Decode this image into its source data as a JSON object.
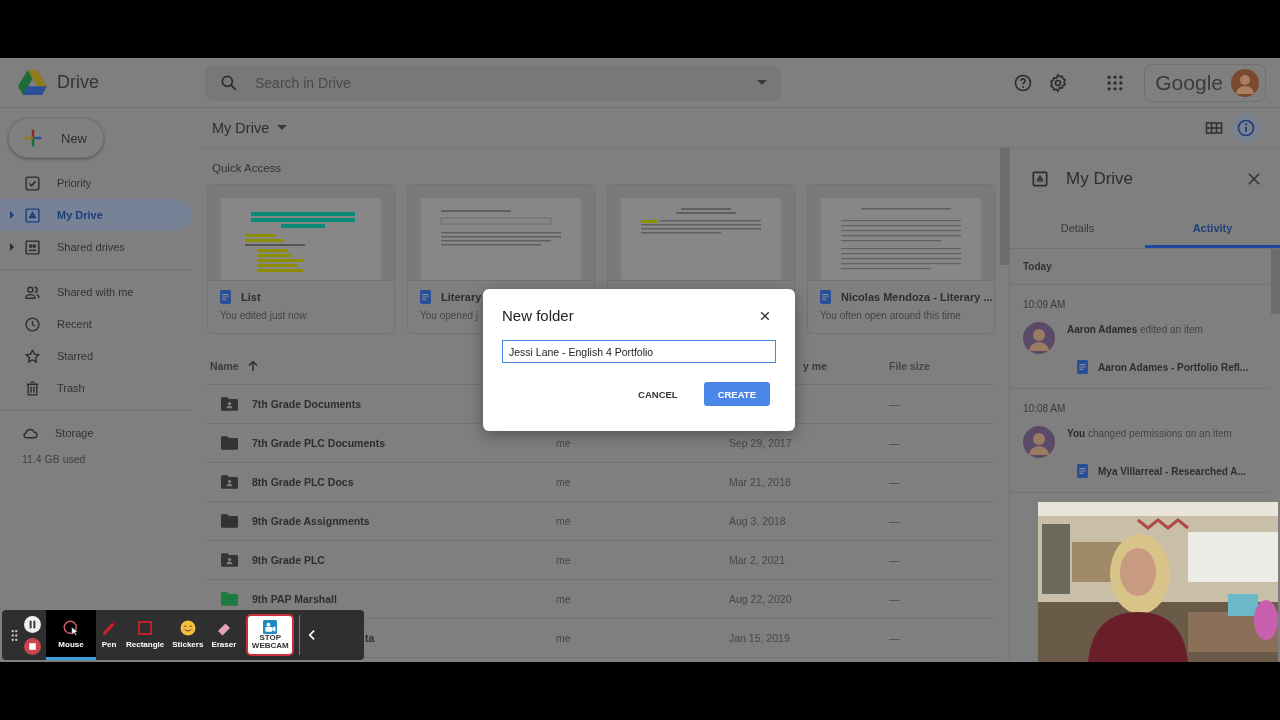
{
  "header": {
    "product": "Drive",
    "search": {
      "placeholder": "Search in Drive"
    },
    "account_label": "Google"
  },
  "sidebar": {
    "new_button": "New",
    "groups": [
      {
        "items": [
          {
            "kind": "priority",
            "label": "Priority",
            "selected": false,
            "expandable": false
          },
          {
            "kind": "my-drive",
            "label": "My Drive",
            "selected": true,
            "expandable": true
          },
          {
            "kind": "shared-drives",
            "label": "Shared drives",
            "selected": false,
            "expandable": true
          }
        ]
      },
      {
        "items": [
          {
            "kind": "shared-with-me",
            "label": "Shared with me",
            "selected": false,
            "expandable": false
          },
          {
            "kind": "recent",
            "label": "Recent",
            "selected": false,
            "expandable": false
          },
          {
            "kind": "starred",
            "label": "Starred",
            "selected": false,
            "expandable": false
          },
          {
            "kind": "trash",
            "label": "Trash",
            "selected": false,
            "expandable": false
          }
        ]
      }
    ],
    "storage": {
      "label": "Storage",
      "usage": "11.4 GB used"
    }
  },
  "main": {
    "title": "My Drive",
    "quick_access": {
      "title": "Quick Access",
      "cards": [
        {
          "kind": "highlighted",
          "name": "List",
          "note": "You edited just now"
        },
        {
          "kind": "form",
          "name": "Literary",
          "note": "You opened j"
        },
        {
          "kind": "labelled"
        },
        {
          "kind": "essay",
          "name": "Nicolas Mendoza - Literary ...",
          "note": "You often open around this time"
        }
      ]
    },
    "table": {
      "columns": {
        "name": "Name",
        "column_3": "y me",
        "file_size": "File size"
      },
      "sort_ascending": true,
      "rows": [
        {
          "kind": "shared",
          "name": "7th Grade Documents",
          "size": "—"
        },
        {
          "kind": "plain",
          "name": "7th Grade PLC Documents",
          "owner": "me",
          "modified": "Sep 29, 2017",
          "size": "—"
        },
        {
          "kind": "shared",
          "name": "8th Grade PLC Docs",
          "owner": "me",
          "modified": "Mar 21, 2018",
          "size": "—"
        },
        {
          "kind": "plain",
          "name": "9th Grade Assignments",
          "owner": "me",
          "modified": "Aug 3, 2018",
          "size": "—"
        },
        {
          "kind": "shared",
          "name": "9th Grade PLC",
          "owner": "me",
          "modified": "Mar 2, 2021",
          "size": "—"
        },
        {
          "kind": "green",
          "name": "9th PAP Marshall",
          "owner": "me",
          "modified": "Aug 22, 2020",
          "size": "—"
        },
        {
          "kind": "covered",
          "name": "ta",
          "owner": "me",
          "modified": "Jan 15, 2019",
          "size": "—"
        }
      ]
    }
  },
  "details_panel": {
    "title": "My Drive",
    "tabs": [
      {
        "label": "Details",
        "selected": false
      },
      {
        "label": "Activity",
        "selected": true
      }
    ],
    "day": "Today",
    "entries": [
      {
        "time": "10:09 AM",
        "text": "**Aaron Adames** edited an item",
        "file": "Aaron Adames - Portfolio Refl..."
      },
      {
        "time": "10:08 AM",
        "text": "**You** changed permissions on an item",
        "file": "Mya Villarreal - Researched A..."
      }
    ]
  },
  "dialog": {
    "title": "New folder",
    "value": "Jessi Lane - English 4 Portfolio",
    "buttons": [
      {
        "kind": "text",
        "label": "CANCEL"
      },
      {
        "kind": "primary",
        "label": "CREATE"
      }
    ]
  },
  "recorder": {
    "tools": [
      {
        "kind": "mouse",
        "label": "Mouse",
        "selected": true
      },
      {
        "kind": "pen",
        "label": "Pen",
        "selected": false
      },
      {
        "kind": "rectangle",
        "label": "Rectangle",
        "selected": false
      },
      {
        "kind": "stickers",
        "label": "Stickers",
        "selected": false
      },
      {
        "kind": "eraser",
        "label": "Eraser",
        "selected": false
      }
    ],
    "webcam_button": "STOP WEBCAM"
  }
}
